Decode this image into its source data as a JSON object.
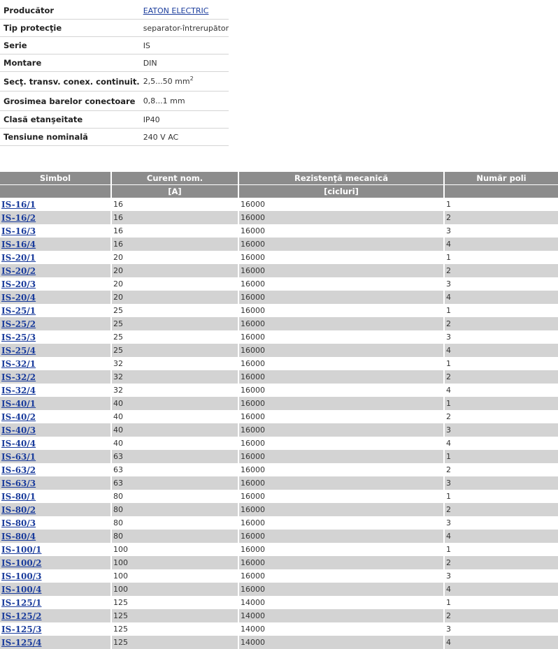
{
  "spec": {
    "producer_label": "Producător",
    "producer_value": "EATON ELECTRIC",
    "protection_label": "Tip protecţie",
    "protection_value": "separator-întrerupător",
    "series_label": "Serie",
    "series_value": "IS",
    "mounting_label": "Montare",
    "mounting_value": "DIN",
    "section_label": "Secţ. transv. conex. continuit.",
    "section_value": "2,5...50 mm",
    "section_exp": "2",
    "bar_label": "Grosimea barelor conectoare",
    "bar_value": "0,8...1 mm",
    "sealing_label": "Clasă etanşeitate",
    "sealing_value": "IP40",
    "voltage_label": "Tensiune nominală",
    "voltage_value": "240 V AC"
  },
  "table": {
    "headers": [
      "Simbol",
      "Curent nom.",
      "Rezistenţă mecanică",
      "Număr poli"
    ],
    "units": [
      "",
      "[A]",
      "[cicluri]",
      ""
    ],
    "rows": [
      [
        "IS-16/1",
        "16",
        "16000",
        "1"
      ],
      [
        "IS-16/2",
        "16",
        "16000",
        "2"
      ],
      [
        "IS-16/3",
        "16",
        "16000",
        "3"
      ],
      [
        "IS-16/4",
        "16",
        "16000",
        "4"
      ],
      [
        "IS-20/1",
        "20",
        "16000",
        "1"
      ],
      [
        "IS-20/2",
        "20",
        "16000",
        "2"
      ],
      [
        "IS-20/3",
        "20",
        "16000",
        "3"
      ],
      [
        "IS-20/4",
        "20",
        "16000",
        "4"
      ],
      [
        "IS-25/1",
        "25",
        "16000",
        "1"
      ],
      [
        "IS-25/2",
        "25",
        "16000",
        "2"
      ],
      [
        "IS-25/3",
        "25",
        "16000",
        "3"
      ],
      [
        "IS-25/4",
        "25",
        "16000",
        "4"
      ],
      [
        "IS-32/1",
        "32",
        "16000",
        "1"
      ],
      [
        "IS-32/2",
        "32",
        "16000",
        "2"
      ],
      [
        "IS-32/4",
        "32",
        "16000",
        "4"
      ],
      [
        "IS-40/1",
        "40",
        "16000",
        "1"
      ],
      [
        "IS-40/2",
        "40",
        "16000",
        "2"
      ],
      [
        "IS-40/3",
        "40",
        "16000",
        "3"
      ],
      [
        "IS-40/4",
        "40",
        "16000",
        "4"
      ],
      [
        "IS-63/1",
        "63",
        "16000",
        "1"
      ],
      [
        "IS-63/2",
        "63",
        "16000",
        "2"
      ],
      [
        "IS-63/3",
        "63",
        "16000",
        "3"
      ],
      [
        "IS-80/1",
        "80",
        "16000",
        "1"
      ],
      [
        "IS-80/2",
        "80",
        "16000",
        "2"
      ],
      [
        "IS-80/3",
        "80",
        "16000",
        "3"
      ],
      [
        "IS-80/4",
        "80",
        "16000",
        "4"
      ],
      [
        "IS-100/1",
        "100",
        "16000",
        "1"
      ],
      [
        "IS-100/2",
        "100",
        "16000",
        "2"
      ],
      [
        "IS-100/3",
        "100",
        "16000",
        "3"
      ],
      [
        "IS-100/4",
        "100",
        "16000",
        "4"
      ],
      [
        "IS-125/1",
        "125",
        "14000",
        "1"
      ],
      [
        "IS-125/2",
        "125",
        "14000",
        "2"
      ],
      [
        "IS-125/3",
        "125",
        "14000",
        "3"
      ],
      [
        "IS-125/4",
        "125",
        "14000",
        "4"
      ]
    ]
  }
}
